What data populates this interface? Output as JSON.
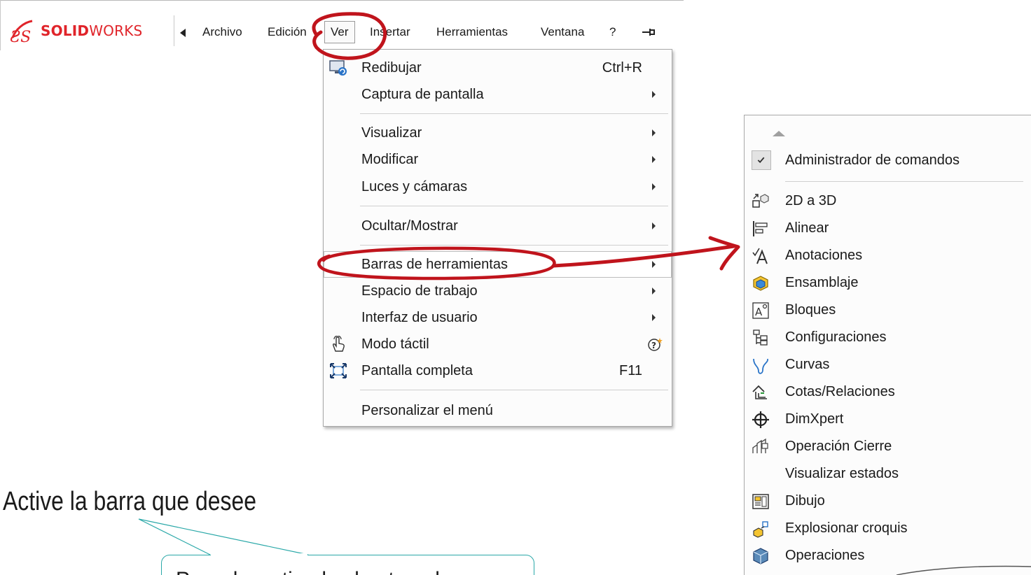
{
  "app": {
    "brand_bold": "SOLID",
    "brand_light": "WORKS",
    "brand_color": "#e0242a"
  },
  "menubar": {
    "items": [
      "Archivo",
      "Edición",
      "Ver",
      "Insertar",
      "Herramientas",
      "Ventana",
      "?"
    ],
    "active": "Ver",
    "back_icon": "caret-left-icon",
    "pin_icon": "pin-icon"
  },
  "view_menu": {
    "items": [
      {
        "label": "Redibujar",
        "shortcut": "Ctrl+R",
        "icon": "redraw-icon",
        "submenu": false
      },
      {
        "label": "Captura de pantalla",
        "submenu": true
      },
      {
        "label": "Visualizar",
        "submenu": true
      },
      {
        "label": "Modificar",
        "submenu": true
      },
      {
        "label": "Luces y cámaras",
        "submenu": true
      },
      {
        "label": "Ocultar/Mostrar",
        "submenu": true
      },
      {
        "label": "Barras de herramientas",
        "submenu": true,
        "highlighted": true
      },
      {
        "label": "Espacio de trabajo",
        "submenu": true
      },
      {
        "label": "Interfaz de usuario",
        "submenu": true
      },
      {
        "label": "Modo táctil",
        "icon": "touch-hand-icon",
        "trailing_icon": "help-icon",
        "submenu": false
      },
      {
        "label": "Pantalla completa",
        "shortcut": "F11",
        "icon": "fullscreen-icon",
        "submenu": false
      },
      {
        "label": "Personalizar el menú",
        "submenu": false
      }
    ]
  },
  "toolbars_menu": {
    "checked_item": "Administrador de comandos",
    "items": [
      {
        "label": "2D a 3D",
        "icon": "2d-to-3d-icon"
      },
      {
        "label": "Alinear",
        "icon": "align-icon"
      },
      {
        "label": "Anotaciones",
        "icon": "annotation-icon"
      },
      {
        "label": "Ensamblaje",
        "icon": "assembly-icon"
      },
      {
        "label": "Bloques",
        "icon": "blocks-icon"
      },
      {
        "label": "Configuraciones",
        "icon": "configurations-icon"
      },
      {
        "label": "Curvas",
        "icon": "curves-icon"
      },
      {
        "label": "Cotas/Relaciones",
        "icon": "dimensions-icon"
      },
      {
        "label": "DimXpert",
        "icon": "dimxpert-icon"
      },
      {
        "label": "Operación Cierre",
        "icon": "closure-icon"
      },
      {
        "label": "Visualizar estados",
        "icon": ""
      },
      {
        "label": "Dibujo",
        "icon": "drawing-icon"
      },
      {
        "label": "Explosionar croquis",
        "icon": "explode-sketch-icon"
      },
      {
        "label": "Operaciones",
        "icon": "features-icon"
      }
    ]
  },
  "annotations": {
    "instruction": "Active la barra que desee",
    "callout": "Para desactivarlas hasta pulsar",
    "highlight_color": "#c0141c",
    "callout_border": "#2aa8a8"
  }
}
